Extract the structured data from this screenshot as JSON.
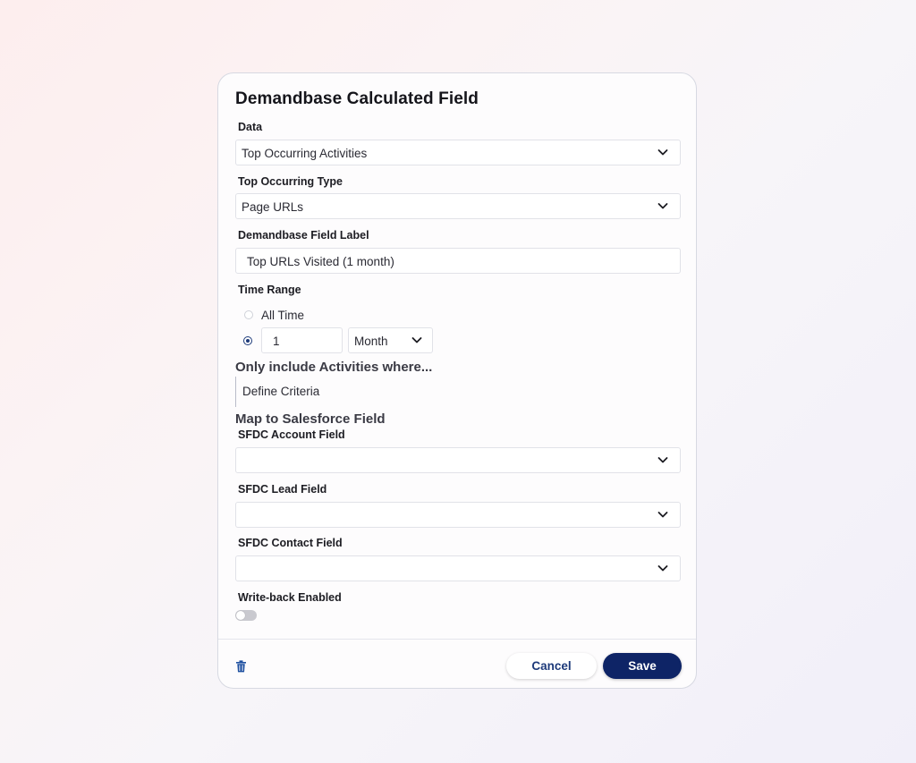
{
  "dialog": {
    "title": "Demandbase Calculated Field"
  },
  "fields": {
    "data": {
      "label": "Data",
      "value": "Top Occurring Activities"
    },
    "top_occurring_type": {
      "label": "Top Occurring Type",
      "value": "Page URLs"
    },
    "field_label": {
      "label": "Demandbase Field Label",
      "value": "Top URLs Visited (1 month)"
    },
    "time_range": {
      "label": "Time Range",
      "options": [
        {
          "label": "All Time",
          "selected": false
        },
        {
          "label": "custom",
          "selected": true
        }
      ],
      "amount": "1",
      "unit": "Month"
    }
  },
  "criteria": {
    "heading": "Only include Activities where...",
    "link": "Define Criteria"
  },
  "salesforce": {
    "heading": "Map to Salesforce Field",
    "account_field": {
      "label": "SFDC Account Field",
      "value": ""
    },
    "lead_field": {
      "label": "SFDC Lead Field",
      "value": ""
    },
    "contact_field": {
      "label": "SFDC Contact Field",
      "value": ""
    },
    "writeback": {
      "label": "Write-back Enabled",
      "enabled": false
    }
  },
  "footer": {
    "delete_icon": "trash-icon",
    "cancel_label": "Cancel",
    "save_label": "Save"
  },
  "colors": {
    "primary": "#0e2466",
    "accent": "#1d3a7a"
  }
}
